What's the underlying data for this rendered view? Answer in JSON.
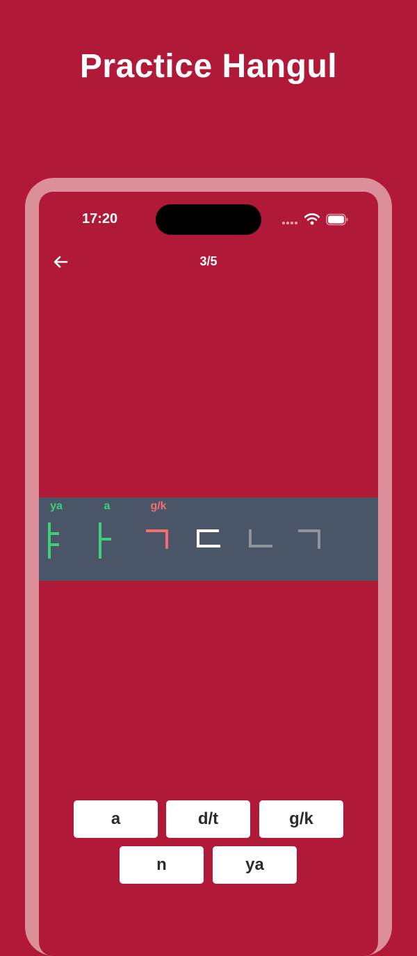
{
  "headline": "Practice Hangul",
  "status_bar": {
    "time": "17:20",
    "icons": [
      "cellular-signal-icon",
      "wifi-icon",
      "battery-icon"
    ]
  },
  "nav": {
    "back_icon": "arrow-left-icon",
    "progress": "3/5"
  },
  "letters": [
    {
      "romanization": "ya",
      "state": "correct",
      "glyph": "ㅑ"
    },
    {
      "romanization": "a",
      "state": "correct",
      "glyph": "ㅏ"
    },
    {
      "romanization": "g/k",
      "state": "wrong",
      "glyph": "ㄱ"
    },
    {
      "romanization": "",
      "state": "current",
      "glyph": "ㄷ"
    },
    {
      "romanization": "",
      "state": "pending",
      "glyph": "ㄴ"
    },
    {
      "romanization": "",
      "state": "pending",
      "glyph": "ㄱ"
    }
  ],
  "answers": [
    "a",
    "d/t",
    "g/k",
    "n",
    "ya"
  ],
  "colors": {
    "background": "#b01a38",
    "frame": "#db8f9a",
    "band": "#4a5668",
    "correct": "#3ecf7a",
    "wrong": "#f07070",
    "current": "#ffffff",
    "pending": "#8e949c"
  }
}
